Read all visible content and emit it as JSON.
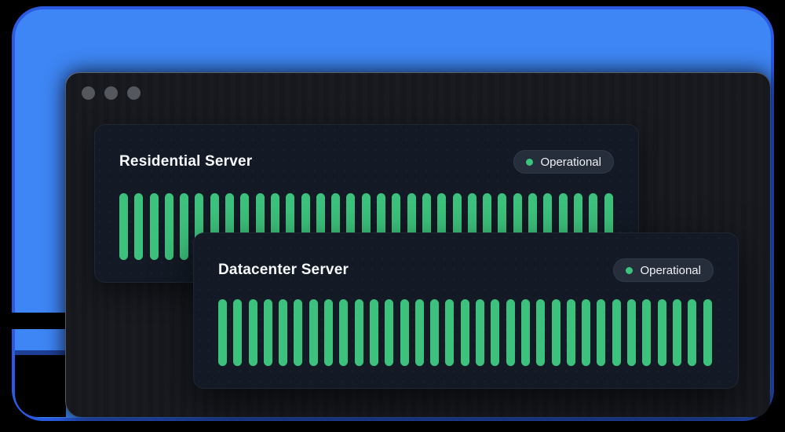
{
  "window": {
    "traffic_lights": [
      "close",
      "minimize",
      "zoom"
    ]
  },
  "cards": [
    {
      "title": "Residential Server",
      "status": {
        "label": "Operational",
        "state": "operational"
      },
      "uptime_bars": {
        "count": 33,
        "state": "up"
      }
    },
    {
      "title": "Datacenter Server",
      "status": {
        "label": "Operational",
        "state": "operational"
      },
      "uptime_bars": {
        "count": 33,
        "state": "up"
      }
    }
  ],
  "colors": {
    "bar_green": "#3cc27c",
    "status_dot_green": "#3ac57e",
    "panel_blue": "#3e86f5",
    "panel_blue_border": "#2b5be0"
  }
}
